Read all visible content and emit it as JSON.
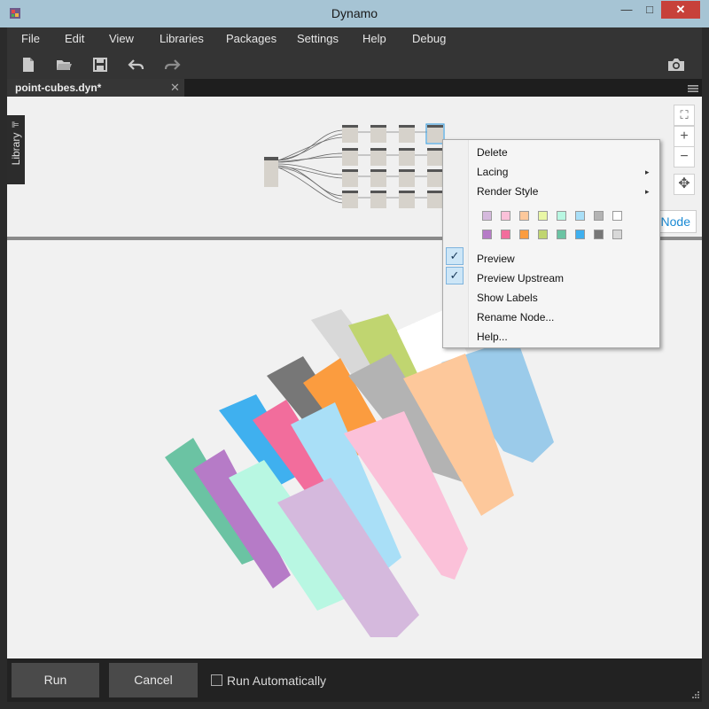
{
  "window": {
    "title": "Dynamo",
    "minimize_glyph": "—",
    "maximize_glyph": "□",
    "close_glyph": "✕"
  },
  "menu": [
    "File",
    "Edit",
    "View",
    "Libraries",
    "Packages",
    "Settings",
    "Help",
    "Debug"
  ],
  "toolbar": {
    "icons": [
      "new-file-icon",
      "open-folder-icon",
      "save-icon",
      "undo-icon",
      "redo-icon",
      "camera-icon"
    ]
  },
  "tab": {
    "label": "point-cubes.dyn*",
    "close_glyph": "✕"
  },
  "library": {
    "label": "Library",
    "arrow": "⊫"
  },
  "zoom": {
    "fit_glyph": "⛶",
    "zoom_in_glyph": "+",
    "zoom_out_glyph": "−",
    "pan_glyph": "✥"
  },
  "node_hint": "Node",
  "context_menu": {
    "items": [
      {
        "label": "Delete"
      },
      {
        "label": "Lacing",
        "submenu": true
      },
      {
        "label": "Render Style",
        "submenu": true
      }
    ],
    "submenu_arrow": "▸",
    "swatches_row1": [
      "#d5b9dd",
      "#fbc1d9",
      "#fdc89b",
      "#e9f7a6",
      "#b8f7e2",
      "#a9dff7",
      "#b3b3b3",
      "#ffffff"
    ],
    "swatches_row2": [
      "#b67bc7",
      "#f26d9c",
      "#fb9c3f",
      "#c0d570",
      "#6bc3a3",
      "#3fb0ef",
      "#777777",
      "#d8d8d8"
    ],
    "toggles": [
      {
        "label": "Preview",
        "checked": true
      },
      {
        "label": "Preview Upstream",
        "checked": true
      }
    ],
    "check_glyph": "✓",
    "actions": [
      {
        "label": "Show Labels"
      },
      {
        "label": "Rename Node..."
      },
      {
        "label": "Help..."
      }
    ]
  },
  "bottom": {
    "run_label": "Run",
    "cancel_label": "Cancel",
    "run_auto_label": "Run Automatically",
    "run_auto_checked": false
  },
  "colors": {
    "accent": "#1a8ad4",
    "close_red": "#c7413a",
    "titlebar": "#a6c4d4"
  }
}
